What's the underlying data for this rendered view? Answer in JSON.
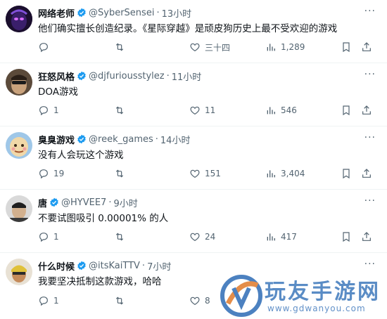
{
  "tweets": [
    {
      "name": "网络老师",
      "handle": "@SyberSensei",
      "sep": "·",
      "time": "13小时",
      "text": "他们确实擅长创造纪录。《星际穿越》是顽皮狗历史上最不受欢迎的游戏",
      "replies": "",
      "retweets": "",
      "likes": "三十四",
      "views": "1,289"
    },
    {
      "name": "狂怒风格",
      "handle": "@djfuriousstylez",
      "sep": "·",
      "time": "11小时",
      "text": "DOA游戏",
      "replies": "1",
      "retweets": "",
      "likes": "11",
      "views": "546"
    },
    {
      "name": "臭臭游戏",
      "handle": "@reek_games",
      "sep": "·",
      "time": "14小时",
      "text": "没有人会玩这个游戏",
      "replies": "19",
      "retweets": "",
      "likes": "151",
      "views": "3,404"
    },
    {
      "name": "唐",
      "handle": "@HYVEE7",
      "sep": "·",
      "time": "9小时",
      "text": "不要试图吸引 0.00001% 的人",
      "replies": "1",
      "retweets": "",
      "likes": "24",
      "views": "417"
    },
    {
      "name": "什么时候",
      "handle": "@itsKaiTTV",
      "sep": "·",
      "time": "7小时",
      "text": "我要坚决抵制这款游戏，哈哈",
      "replies": "1",
      "retweets": "",
      "likes": "8",
      "views": ""
    }
  ],
  "more_glyph": "···",
  "watermark": {
    "text": "玩友手游网",
    "url": "www.gdwanyou.com"
  },
  "colors": {
    "verified": "#1d9bf0",
    "muted": "#536471",
    "text": "#0f1419",
    "watermark": "#2d6cb6"
  }
}
